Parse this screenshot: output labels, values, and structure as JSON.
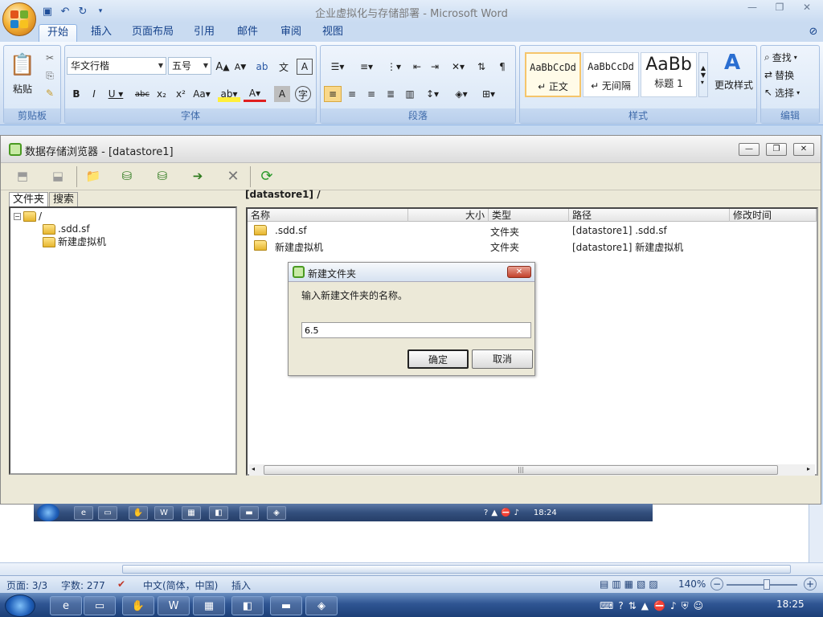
{
  "word": {
    "title": "企业虚拟化与存储部署 - Microsoft Word",
    "tabs": [
      "开始",
      "插入",
      "页面布局",
      "引用",
      "邮件",
      "审阅",
      "视图"
    ],
    "clipboard": {
      "paste": "粘贴",
      "group": "剪贴板"
    },
    "font": {
      "name": "华文行楷",
      "size": "五号",
      "group": "字体"
    },
    "paragraph": {
      "group": "段落"
    },
    "styles": {
      "group": "样式",
      "items": [
        {
          "sample": "AaBbCcDd",
          "name": "↵ 正文"
        },
        {
          "sample": "AaBbCcDd",
          "name": "↵ 无间隔"
        },
        {
          "sample": "AaBb",
          "name": "标题 1"
        }
      ],
      "change": "更改样式"
    },
    "editing": {
      "group": "编辑",
      "find": "查找",
      "replace": "替换",
      "select": "选择"
    },
    "status": {
      "page": "页面: 3/3",
      "words": "字数: 277",
      "lang": "中文(简体，中国)",
      "mode": "插入",
      "zoom": "140%"
    }
  },
  "browser": {
    "title": "数据存储浏览器 - [datastore1]",
    "tabs": [
      "文件夹",
      "搜索"
    ],
    "tree": {
      "root": "/",
      "children": [
        ".sdd.sf",
        "新建虚拟机"
      ]
    },
    "breadcrumb": "[datastore1] /",
    "columns": [
      "名称",
      "大小",
      "类型",
      "路径",
      "修改时间"
    ],
    "rows": [
      {
        "name": ".sdd.sf",
        "size": "",
        "type": "文件夹",
        "path": "[datastore1] .sdd.sf"
      },
      {
        "name": "新建虚拟机",
        "size": "",
        "type": "文件夹",
        "path": "[datastore1] 新建虚拟机"
      }
    ]
  },
  "dialog": {
    "title": "新建文件夹",
    "prompt": "输入新建文件夹的名称。",
    "value": "6.5",
    "ok": "确定",
    "cancel": "取消"
  },
  "inner_taskbar": {
    "clock": "18:24"
  },
  "taskbar": {
    "clock": "18:25"
  },
  "colors": {
    "word_accent": "#15428b",
    "taskbar": "#2f5593",
    "dialog_close": "#c3412b"
  }
}
